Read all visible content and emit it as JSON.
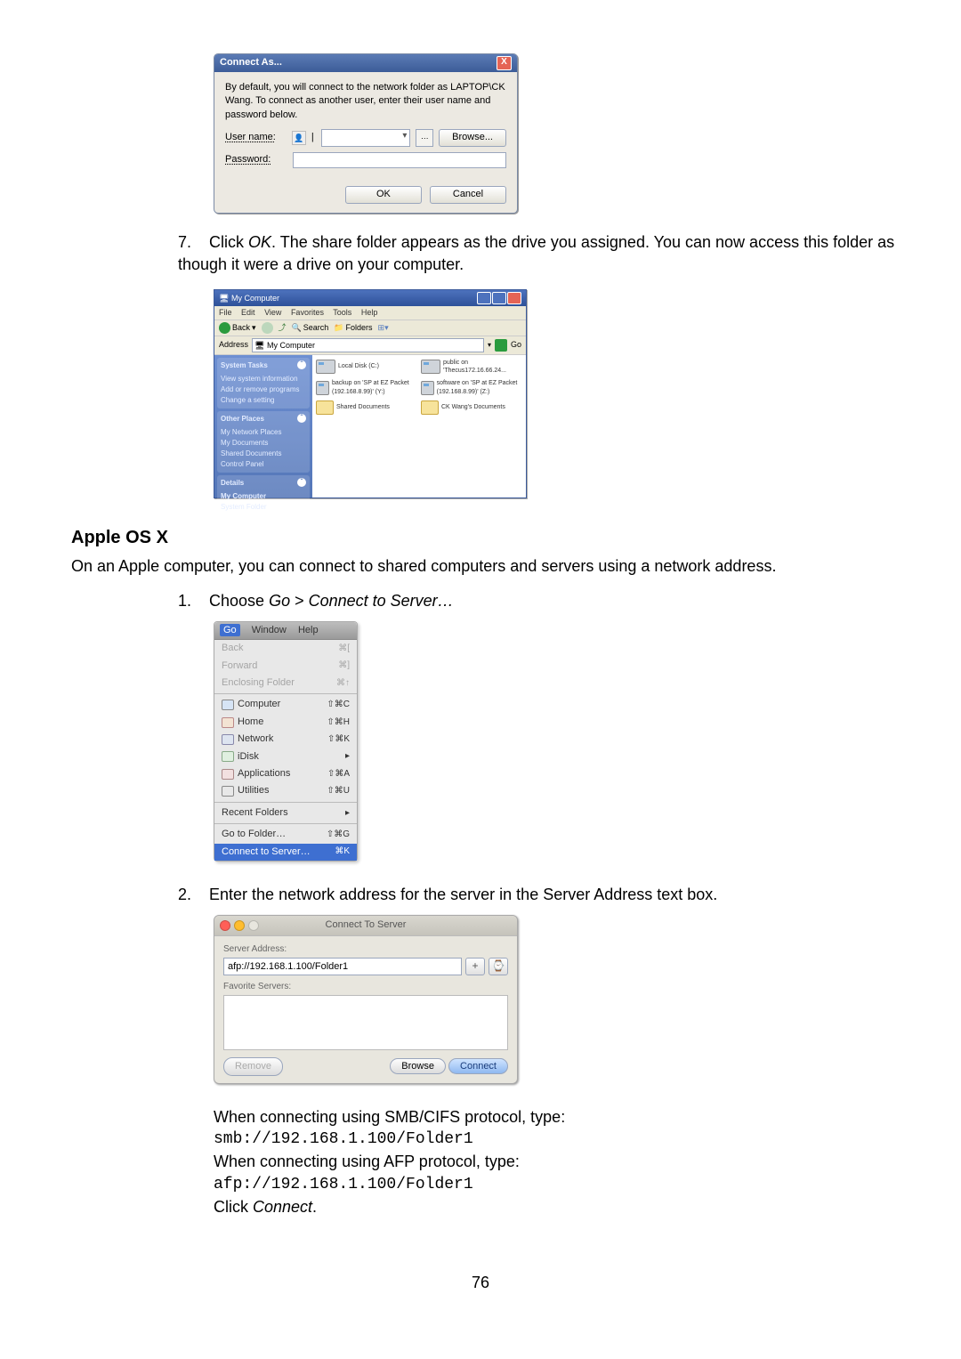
{
  "connect_as": {
    "title": "Connect As...",
    "close": "X",
    "message": "By default, you will connect to the network folder as LAPTOP\\CK Wang. To connect as another user, enter their user name and password below.",
    "user_label": "User name:",
    "pass_label": "Password:",
    "browse": "Browse...",
    "ok": "OK",
    "cancel": "Cancel"
  },
  "step7": {
    "num": "7.",
    "text_a": "Click ",
    "ok": "OK",
    "text_b": ". The share folder appears as the drive you assigned. You can now access this folder as though it were a drive on your computer."
  },
  "explorer": {
    "title": "My Computer",
    "menu": {
      "file": "File",
      "edit": "Edit",
      "view": "View",
      "fav": "Favorites",
      "tools": "Tools",
      "help": "Help"
    },
    "toolbar": {
      "back": "Back",
      "search": "Search",
      "folders": "Folders"
    },
    "address_label": "Address",
    "address_value": "My Computer",
    "go": "Go",
    "panels": {
      "system": {
        "title": "System Tasks",
        "i1": "View system information",
        "i2": "Add or remove programs",
        "i3": "Change a setting"
      },
      "other": {
        "title": "Other Places",
        "i1": "My Network Places",
        "i2": "My Documents",
        "i3": "Shared Documents",
        "i4": "Control Panel"
      },
      "details": {
        "title": "Details",
        "i1": "My Computer",
        "i2": "System Folder"
      }
    },
    "items": {
      "c": "Local Disk (C:)",
      "p": "public on\n'Thecus172.16.66.24...",
      "z": "backup on 'SP at EZ Packet (192.168.8.99)' (Y:)",
      "e": "software on 'SP at EZ Packet (192.168.8.99)' (Z:)",
      "sd": "Shared Documents",
      "ck": "CK Wang's Documents"
    }
  },
  "apple": {
    "heading": "Apple OS X",
    "intro": "On an Apple computer, you can connect to shared computers and servers using a network address."
  },
  "step_a1": {
    "num": "1.",
    "text_a": "Choose ",
    "go": "Go",
    "gt": " > ",
    "cts": "Connect to Server…"
  },
  "macmenu": {
    "go": "Go",
    "window": "Window",
    "help": "Help",
    "back": "Back",
    "back_sc": "⌘[",
    "forward": "Forward",
    "fwd_sc": "⌘]",
    "encl": "Enclosing Folder",
    "encl_sc": "⌘↑",
    "computer": "Computer",
    "computer_sc": "⇧⌘C",
    "home": "Home",
    "home_sc": "⇧⌘H",
    "network": "Network",
    "network_sc": "⇧⌘K",
    "idisk": "iDisk",
    "idisk_sc": "▸",
    "apps": "Applications",
    "apps_sc": "⇧⌘A",
    "util": "Utilities",
    "util_sc": "⇧⌘U",
    "recent": "Recent Folders",
    "recent_sc": "▸",
    "gtf": "Go to Folder…",
    "gtf_sc": "⇧⌘G",
    "cts": "Connect to Server…",
    "cts_sc": "⌘K"
  },
  "step_a2": {
    "num": "2.",
    "text": "Enter the network address for the server in the Server Address text box."
  },
  "cts": {
    "title": "Connect To Server",
    "sa_label": "Server Address:",
    "sa_value": "afp://192.168.1.100/Folder1",
    "fs_label": "Favorite Servers:",
    "plus": "+",
    "hist": "⌚",
    "remove": "Remove",
    "browse": "Browse",
    "connect": "Connect"
  },
  "after": {
    "l1": "When connecting using SMB/CIFS protocol, type:",
    "c1": "smb://192.168.1.100/Folder1",
    "l2": "When connecting using AFP protocol, type:",
    "c2": "afp://192.168.1.100/Folder1",
    "l3a": "Click ",
    "l3b": "Connect",
    "l3c": "."
  },
  "page_num": "76"
}
